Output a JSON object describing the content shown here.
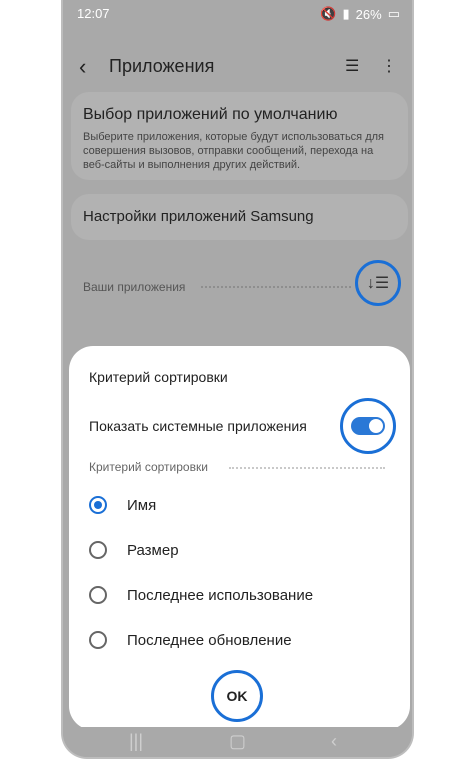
{
  "status_bar": {
    "time": "12:07",
    "mute_icon": "mute-icon",
    "battery": "26%"
  },
  "app_bar": {
    "title": "Приложения"
  },
  "default_apps": {
    "title": "Выбор приложений по умолчанию",
    "description": "Выберите приложения, которые будут использоваться для совершения вызовов, отправки сообщений, перехода на веб-сайты и выполнения других действий."
  },
  "samsung_settings": {
    "title": "Настройки приложений Samsung"
  },
  "your_apps_label": "Ваши приложения",
  "sort_sheet": {
    "title": "Критерий сортировки",
    "show_system_label": "Показать системные приложения",
    "show_system_on": true,
    "section_label": "Критерий сортировки",
    "options": [
      {
        "label": "Имя",
        "selected": true
      },
      {
        "label": "Размер",
        "selected": false
      },
      {
        "label": "Последнее использование",
        "selected": false
      },
      {
        "label": "Последнее обновление",
        "selected": false
      }
    ],
    "ok_label": "OK"
  },
  "colors": {
    "accent": "#1a6fd6",
    "dim_background": "#a9a9a9"
  }
}
